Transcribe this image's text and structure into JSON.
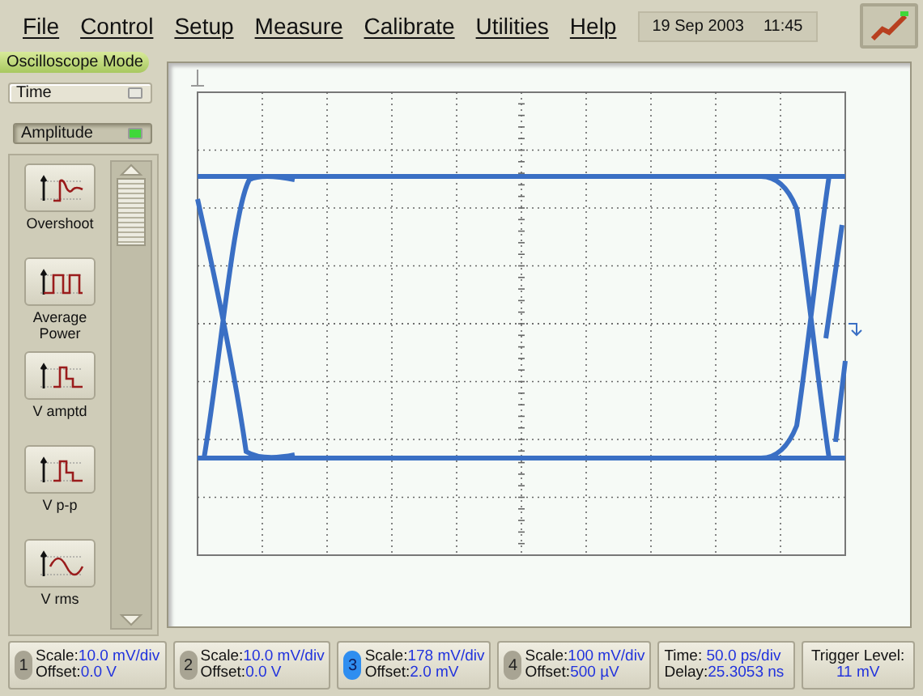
{
  "menu": {
    "items": [
      "File",
      "Control",
      "Setup",
      "Measure",
      "Calibrate",
      "Utilities",
      "Help"
    ]
  },
  "datetime": {
    "date": "19 Sep 2003",
    "time": "11:45"
  },
  "mode": "Oscilloscope Mode",
  "categories": [
    {
      "label": "Time",
      "selected": false
    },
    {
      "label": "Amplitude",
      "selected": true
    }
  ],
  "measurements": [
    {
      "label": "Overshoot",
      "kind": "overshoot"
    },
    {
      "label": "Average Power",
      "kind": "square"
    },
    {
      "label": "V amptd",
      "kind": "pulse"
    },
    {
      "label": "V p-p",
      "kind": "pulse"
    },
    {
      "label": "V rms",
      "kind": "sine"
    }
  ],
  "channels": [
    {
      "number": "1",
      "scale_label": "Scale:",
      "scale": "10.0 mV/div",
      "offset_label": "Offset:",
      "offset": "0.0 V",
      "selected": false
    },
    {
      "number": "2",
      "scale_label": "Scale:",
      "scale": "10.0 mV/div",
      "offset_label": "Offset:",
      "offset": "0.0 V",
      "selected": false
    },
    {
      "number": "3",
      "scale_label": "Scale:",
      "scale": "178 mV/div",
      "offset_label": "Offset:",
      "offset": "2.0 mV",
      "selected": true
    },
    {
      "number": "4",
      "scale_label": "Scale:",
      "scale": "100 mV/div",
      "offset_label": "Offset:",
      "offset": "500 µV",
      "selected": false
    }
  ],
  "timebase": {
    "time_label": "Time:",
    "time": "50.0 ps/div",
    "delay_label": "Delay:",
    "delay": "25.3053 ns"
  },
  "trigger": {
    "label": "Trigger Level:",
    "value": "11 mV"
  }
}
